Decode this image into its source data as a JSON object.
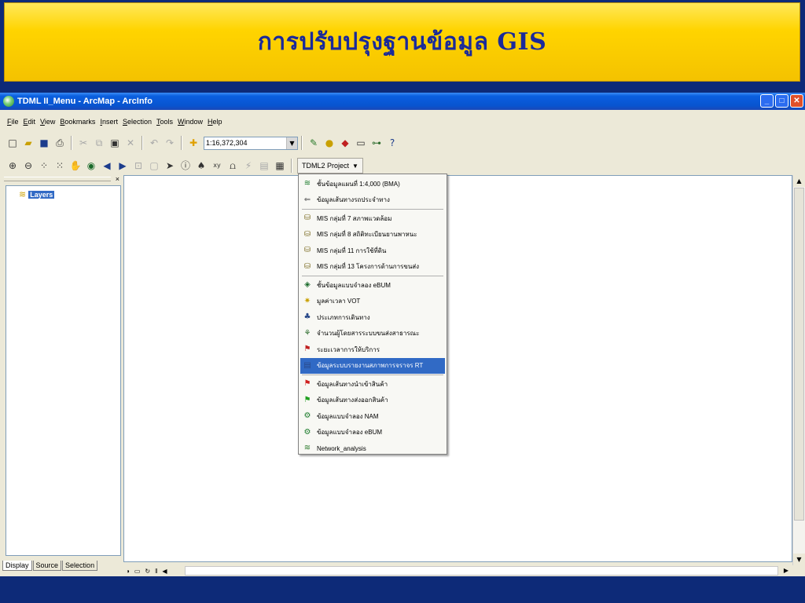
{
  "slide": {
    "title": "การปรับปรุงฐานข้อมูล GIS"
  },
  "window": {
    "title": "TDML II_Menu - ArcMap - ArcInfo",
    "controls": {
      "minimize": "_",
      "maximize": "□",
      "close": "✕"
    }
  },
  "menubar": {
    "items": [
      "File",
      "Edit",
      "View",
      "Bookmarks",
      "Insert",
      "Selection",
      "Tools",
      "Window",
      "Help"
    ]
  },
  "toolbar": {
    "scale_value": "1:16,372,304",
    "project_button": "TDML2 Project"
  },
  "toc": {
    "root_layer": "Layers",
    "close_glyph": "×",
    "tabs": [
      "Display",
      "Source",
      "Selection"
    ]
  },
  "dropdown": {
    "groups": [
      [
        {
          "label": "ชั้นข้อมูลแผนที่ 1:4,000 (BMA)",
          "icon": "layer-stack-icon"
        },
        {
          "label": "ข้อมูลเส้นทางรถประจำทาง",
          "icon": "bus-route-icon"
        }
      ],
      [
        {
          "label": "MIS กลุ่มที่ 7 สภาพแวดล้อม",
          "icon": "database-icon"
        },
        {
          "label": "MIS กลุ่มที่ 8 สถิติทะเบียนยานพาหนะ",
          "icon": "database-icon"
        },
        {
          "label": "MIS กลุ่มที่ 11 การใช้ที่ดิน",
          "icon": "database-icon"
        },
        {
          "label": "MIS กลุ่มที่ 13 โครงการด้านการขนส่ง",
          "icon": "database-icon"
        }
      ],
      [
        {
          "label": "ชั้นข้อมูลแบบจำลอง eBUM",
          "icon": "model-layer-icon"
        },
        {
          "label": "มูลค่าเวลา VOT",
          "icon": "time-value-icon"
        },
        {
          "label": "ประเภทการเดินทาง",
          "icon": "travel-type-icon"
        },
        {
          "label": "จำนวนผู้โดยสารระบบขนส่งสาธารณะ",
          "icon": "passenger-icon"
        },
        {
          "label": "ระยะเวลาการให้บริการ",
          "icon": "service-time-icon"
        },
        {
          "label": "ข้อมูลระบบรายงานสภาพการจราจร RT",
          "icon": "traffic-report-icon",
          "highlighted": true
        }
      ],
      [
        {
          "label": "ข้อมูลเส้นทางนำเข้าสินค้า",
          "icon": "red-flag-icon"
        },
        {
          "label": "ข้อมูลเส้นทางส่งออกสินค้า",
          "icon": "green-flag-icon"
        },
        {
          "label": "ข้อมูลแบบจำลอง NAM",
          "icon": "model-gear-icon"
        },
        {
          "label": "ข้อมูลแบบจำลอง eBUM",
          "icon": "model-gear-icon"
        },
        {
          "label": "Network_analysis",
          "icon": "network-icon"
        }
      ]
    ]
  },
  "colors": {
    "highlight": "#316ac5",
    "title_text": "#1a2a9a",
    "banner": "#ffd400",
    "slide_bg": "#0d2a78"
  }
}
